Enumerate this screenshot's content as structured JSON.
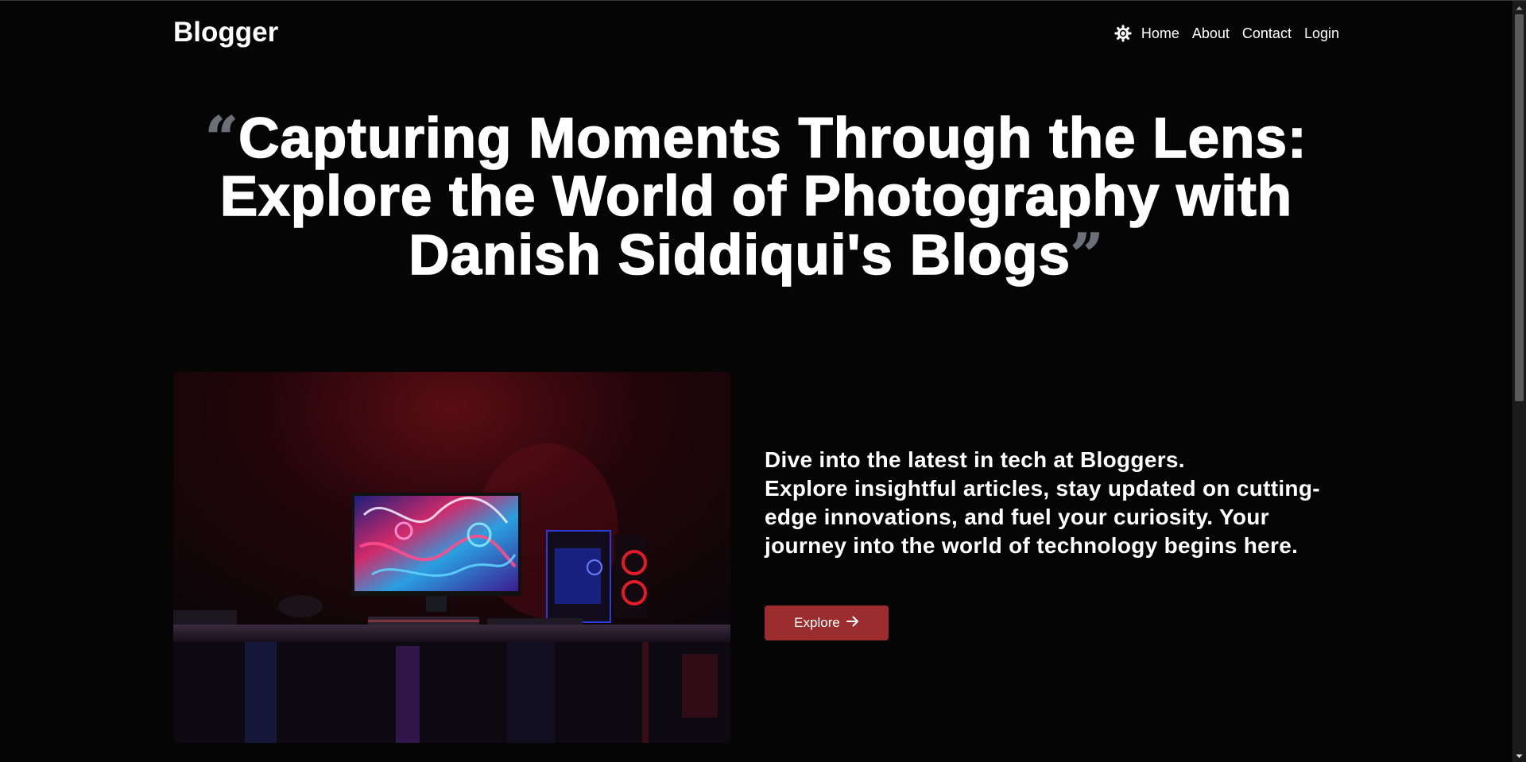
{
  "brand": "Blogger",
  "nav": {
    "theme_icon": "sun-gear-icon",
    "links": [
      "Home",
      "About",
      "Contact",
      "Login"
    ]
  },
  "headline": {
    "open_quote": "“",
    "text": "Capturing Moments Through the Lens: Explore the World of Photography with Danish Siddiqui's Blogs",
    "close_quote": "”"
  },
  "hero_image": {
    "alt": "Gaming desk setup with monitor and PC in red and blue light"
  },
  "intro": {
    "line1": "Dive into the latest in tech at Bloggers.",
    "line2": "Explore insightful articles, stay updated on cutting-edge innovations, and fuel your curiosity. Your journey into the world of technology begins here."
  },
  "explore_button": {
    "label": "Explore",
    "icon": "arrow-right-icon"
  },
  "colors": {
    "background": "#050506",
    "quote_mark": "#6b6f78",
    "button": "#9b2d2f"
  }
}
